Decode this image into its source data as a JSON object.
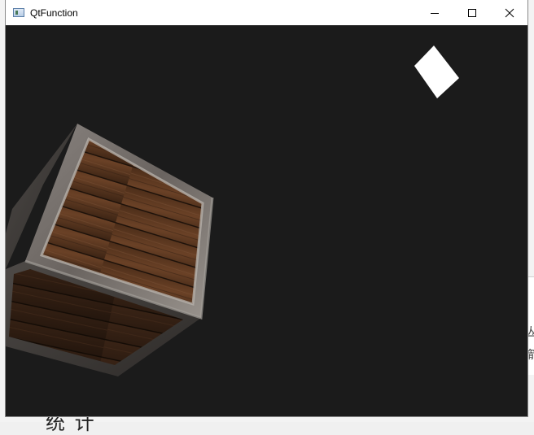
{
  "window": {
    "title": "QtFunction",
    "controls": {
      "minimize_icon": "minimize-icon",
      "maximize_icon": "maximize-icon",
      "close_icon": "close-icon"
    }
  },
  "background": {
    "partial_text_bottom": "统 计",
    "right_glyph_1": "丛",
    "right_glyph_2": "箭"
  },
  "scene": {
    "background_color": "#1b1b1b",
    "light_cube_color": "#ffffff",
    "crate_wood_color": "#5a3820",
    "crate_metal_color": "#6e6a66"
  }
}
